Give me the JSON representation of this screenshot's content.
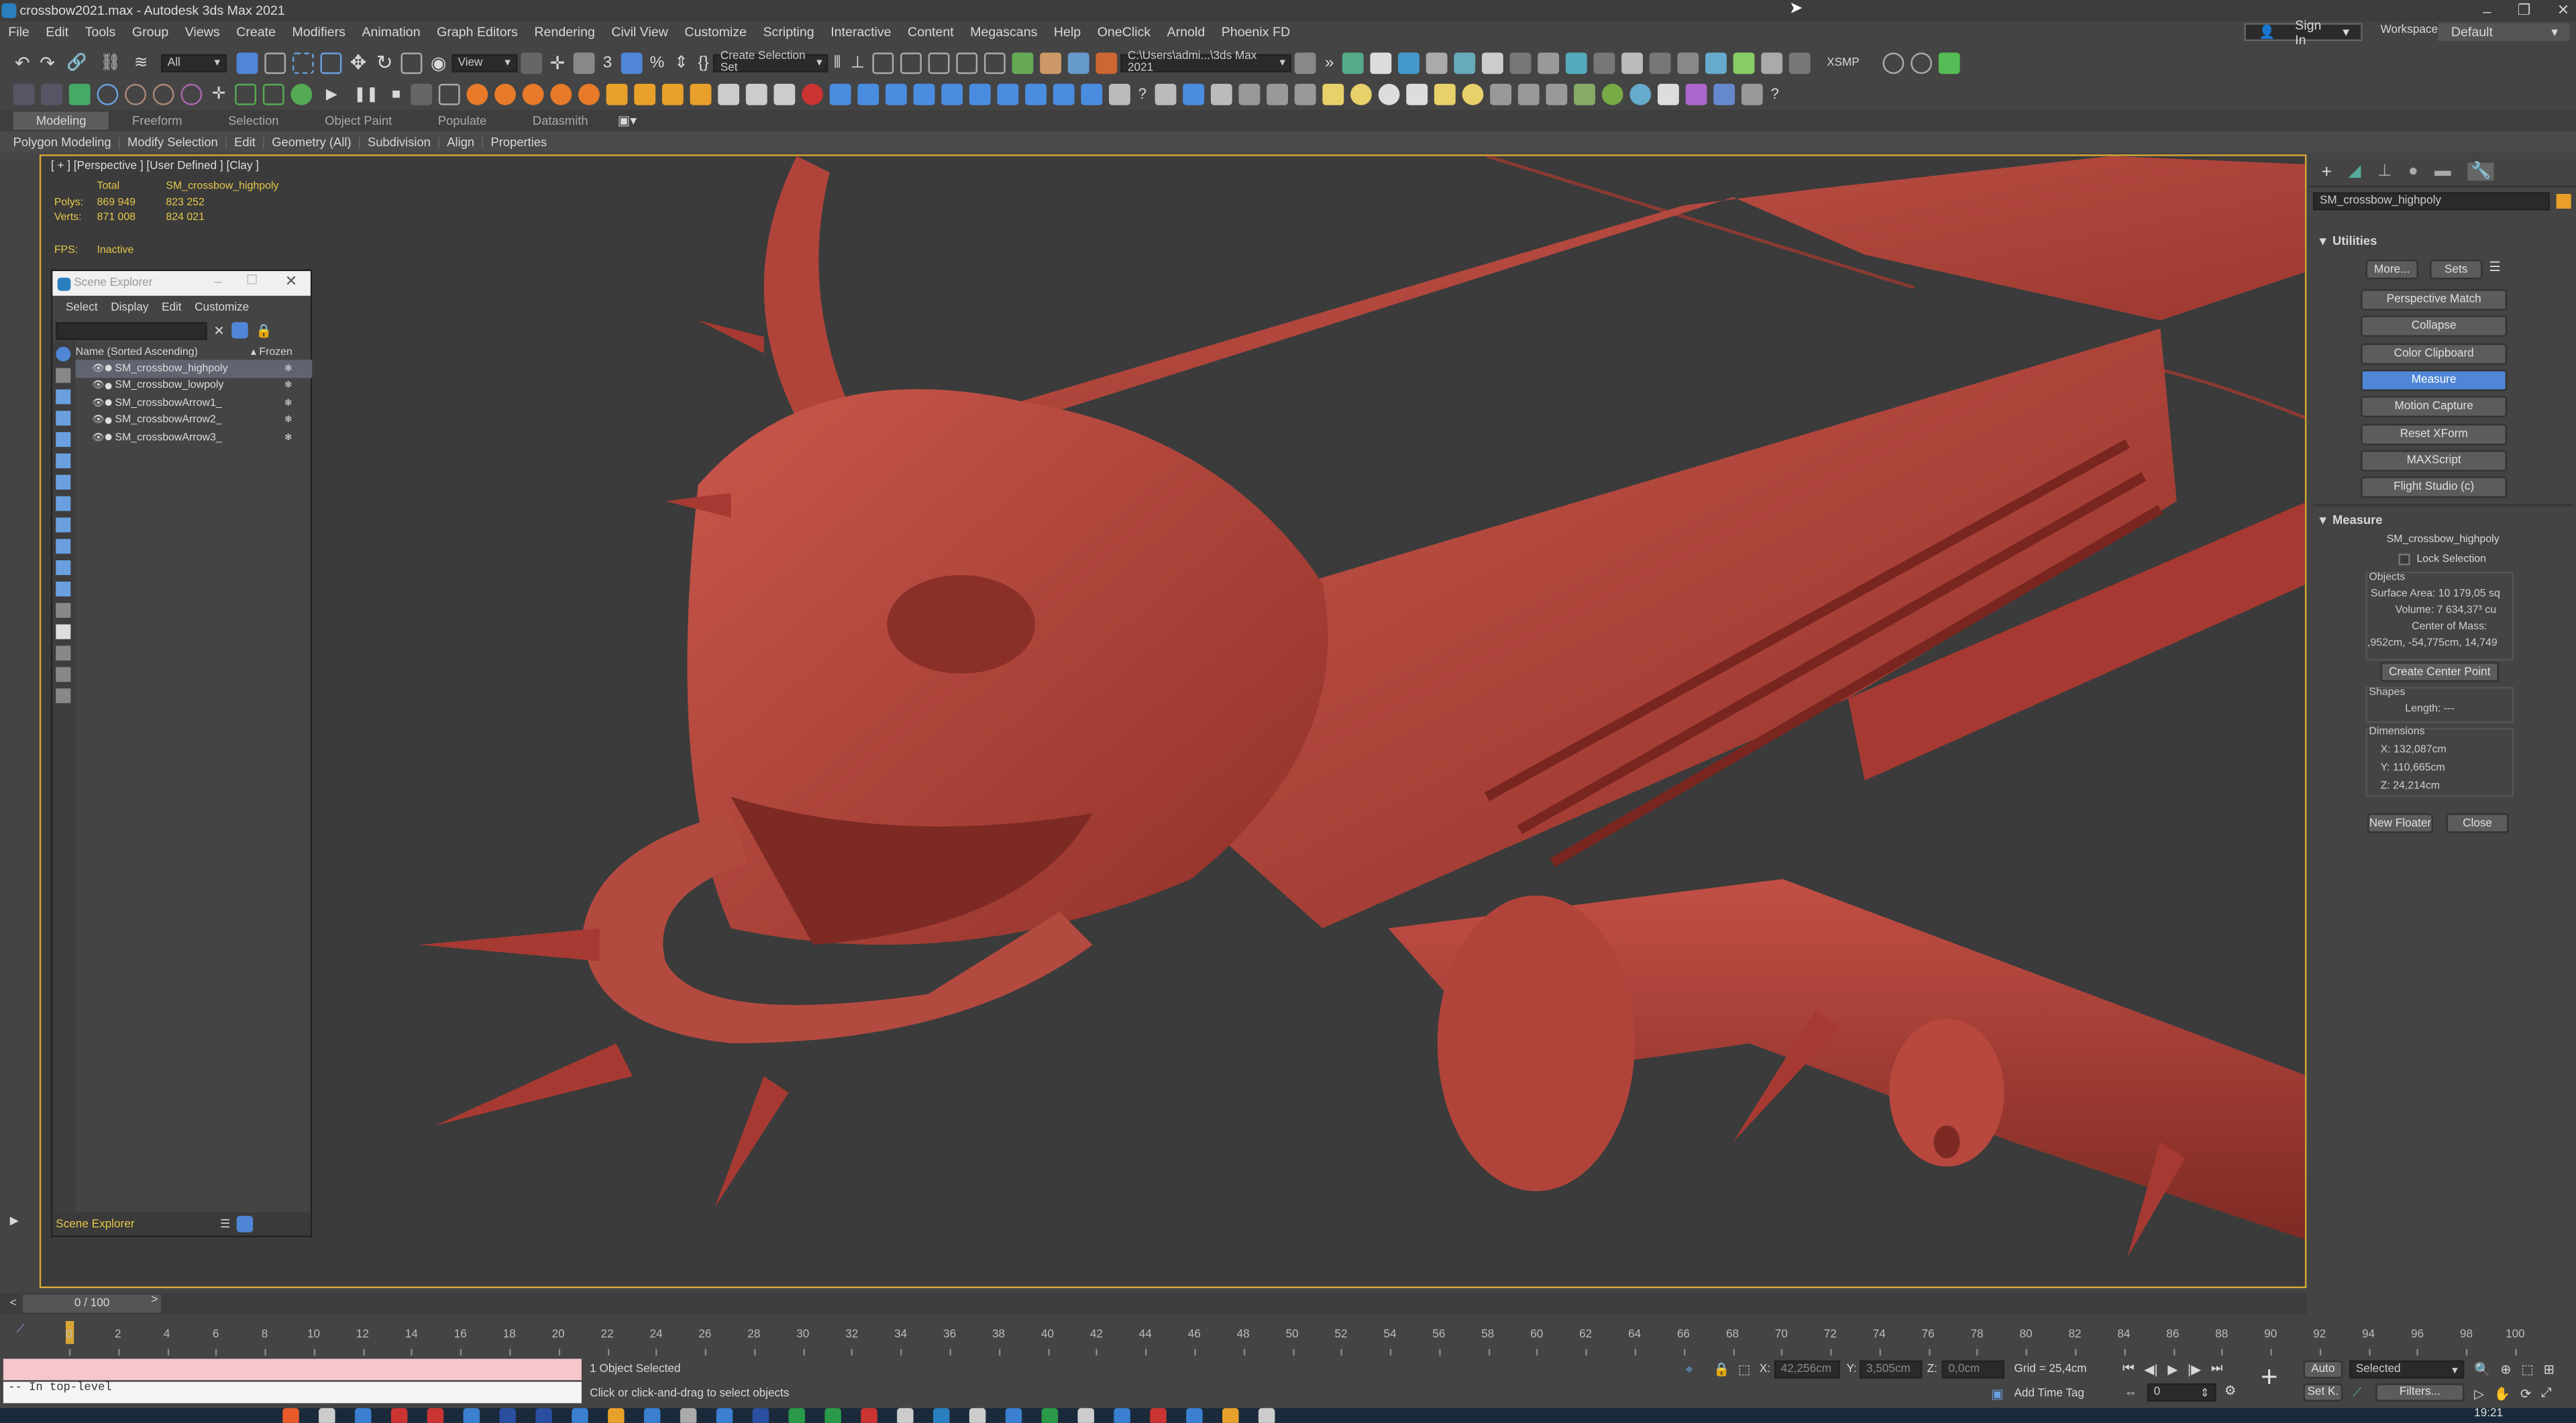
{
  "window": {
    "title": "crossbow2021.max - Autodesk 3ds Max 2021"
  },
  "menu": [
    "File",
    "Edit",
    "Tools",
    "Group",
    "Views",
    "Create",
    "Modifiers",
    "Animation",
    "Graph Editors",
    "Rendering",
    "Civil View",
    "Customize",
    "Scripting",
    "Interactive",
    "Content",
    "Megascans",
    "Help",
    "OneClick",
    "Arnold",
    "Phoenix FD"
  ],
  "account": {
    "sign_in": "Sign In",
    "workspaces_label": "Workspaces:",
    "workspace": "Default"
  },
  "toolbar": {
    "selection_filter": "All",
    "ref_coord": "View",
    "selection_set": "Create Selection Set",
    "project_path": "C:\\Users\\admi...\\3ds Max 2021",
    "xsmp": "XSMP"
  },
  "ribbon": {
    "tabs": [
      "Modeling",
      "Freeform",
      "Selection",
      "Object Paint",
      "Populate",
      "Datasmith"
    ],
    "subtabs": [
      "Polygon Modeling",
      "Modify Selection",
      "Edit",
      "Geometry (All)",
      "Subdivision",
      "Align",
      "Properties"
    ]
  },
  "viewport": {
    "label": "[ + ] [Perspective ] [User Defined ] [Clay ]",
    "stats": {
      "total_label": "Total",
      "object_label": "SM_crossbow_highpoly",
      "polys_label": "Polys:",
      "polys_total": "869 949",
      "polys_object": "823 252",
      "verts_label": "Verts:",
      "verts_total": "871 008",
      "verts_object": "824 021",
      "fps_label": "FPS:",
      "fps_value": "Inactive"
    },
    "model_color": "#b3453d",
    "background": "#3b3b3b"
  },
  "scene_explorer": {
    "title": "Scene Explorer",
    "menu": [
      "Select",
      "Display",
      "Edit",
      "Customize"
    ],
    "col_name": "Name (Sorted Ascending)",
    "col_frozen": "▴ Frozen",
    "items": [
      "SM_crossbow_highpoly",
      "SM_crossbow_lowpoly",
      "SM_crossbowArrow1_",
      "SM_crossbowArrow2_",
      "SM_crossbowArrow3_"
    ],
    "footer": "Scene Explorer"
  },
  "command_panel": {
    "object_name": "SM_crossbow_highpoly",
    "utilities_title": "Utilities",
    "more": "More...",
    "sets": "Sets",
    "utility_buttons": [
      "Perspective Match",
      "Collapse",
      "Color Clipboard",
      "Measure",
      "Motion Capture",
      "Reset XForm",
      "MAXScript",
      "Flight Studio (c)"
    ],
    "active_utility": "Measure",
    "measure": {
      "title": "Measure",
      "object": "SM_crossbow_highpoly",
      "lock_selection": "Lock Selection",
      "objects_label": "Objects",
      "surface_area": "Surface Area: 10 179,05 sq",
      "volume": "Volume: 7 634,37³ cu",
      "center_label": "Center of Mass:",
      "center_value": ",952cm, -54,775cm, 14,749",
      "create_center": "Create Center Point",
      "shapes_label": "Shapes",
      "length": "Length: ---",
      "dimensions_label": "Dimensions",
      "x": "X:  132,087cm",
      "y": "Y:  110,665cm",
      "z": "Z:  24,214cm",
      "new_floater": "New Floater",
      "close": "Close"
    }
  },
  "timeline": {
    "frame_display": "0 / 100",
    "ticks": [
      "0",
      "2",
      "4",
      "6",
      "8",
      "10",
      "12",
      "14",
      "16",
      "18",
      "20",
      "22",
      "24",
      "26",
      "28",
      "30",
      "32",
      "34",
      "36",
      "38",
      "40",
      "42",
      "44",
      "46",
      "48",
      "50",
      "52",
      "54",
      "56",
      "58",
      "60",
      "62",
      "64",
      "66",
      "68",
      "70",
      "72",
      "74",
      "76",
      "78",
      "80",
      "82",
      "84",
      "86",
      "88",
      "90",
      "92",
      "94",
      "96",
      "98",
      "100"
    ]
  },
  "status": {
    "maxscript": "-- In top-level",
    "selected": "1 Object Selected",
    "prompt": "Click or click-and-drag to select objects",
    "x_label": "X:",
    "x_value": "42,256cm",
    "y_label": "Y:",
    "y_value": "3,505cm",
    "z_label": "Z:",
    "z_value": "0,0cm",
    "grid": "Grid = 25,4cm",
    "add_time_tag": "Add Time Tag",
    "auto": "Auto",
    "set_key": "Set K.",
    "key_filter": "Selected",
    "filters": "Filters...",
    "frame": "0",
    "clock": "19:21"
  }
}
